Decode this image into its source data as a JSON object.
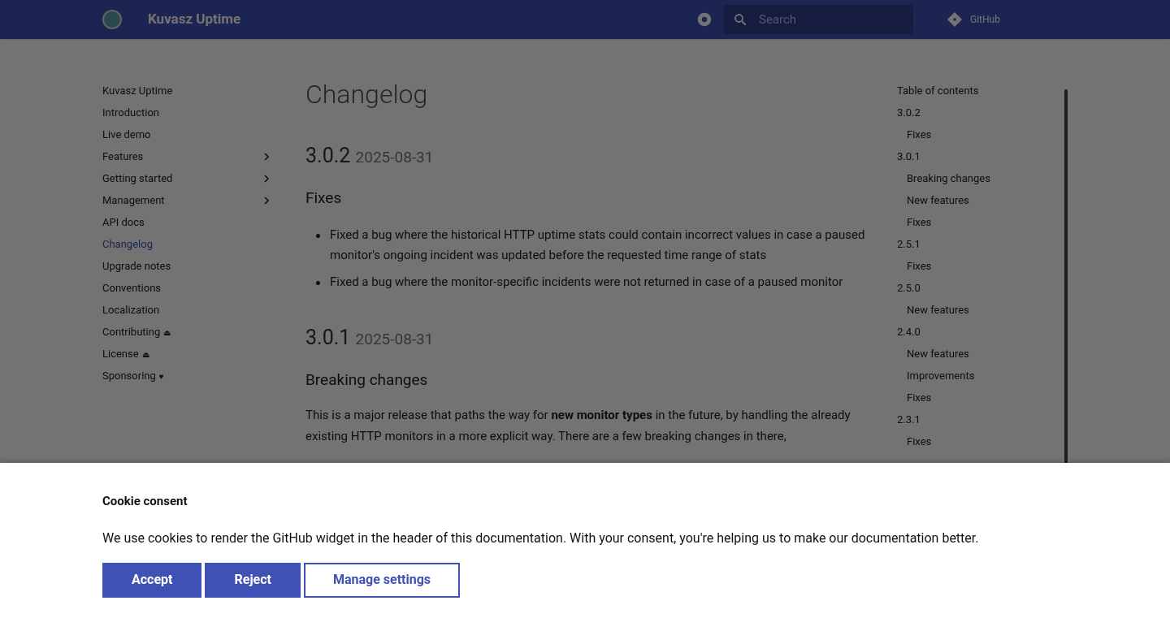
{
  "header": {
    "title": "Kuvasz Uptime",
    "search": {
      "placeholder": "Search"
    },
    "repo_link": "GitHub"
  },
  "sidebar": {
    "items": [
      {
        "label": "Kuvasz Uptime",
        "selected": false,
        "expandable": false
      },
      {
        "label": "Introduction",
        "selected": false,
        "expandable": false
      },
      {
        "label": "Live demo",
        "selected": false,
        "expandable": false
      },
      {
        "label": "Features",
        "selected": false,
        "expandable": true
      },
      {
        "label": "Getting started",
        "selected": false,
        "expandable": true
      },
      {
        "label": "Management",
        "selected": false,
        "expandable": true
      },
      {
        "label": "API docs",
        "selected": false,
        "expandable": false
      },
      {
        "label": "Changelog",
        "selected": true,
        "expandable": false
      },
      {
        "label": "Upgrade notes",
        "selected": false,
        "expandable": false
      },
      {
        "label": "Conventions",
        "selected": false,
        "expandable": false
      },
      {
        "label": "Localization",
        "selected": false,
        "expandable": false
      },
      {
        "label": "Contributing",
        "selected": false,
        "expandable": false,
        "suffix": "⏏"
      },
      {
        "label": "License",
        "selected": false,
        "expandable": false,
        "suffix": "⏏"
      },
      {
        "label": "Sponsoring",
        "selected": false,
        "expandable": false,
        "suffix": "♥"
      }
    ]
  },
  "content": {
    "title": "Changelog",
    "sections": [
      {
        "version": "3.0.2",
        "date": "2025-08-31",
        "subsections": [
          {
            "heading": "Fixes",
            "bullets": [
              "Fixed a bug where the historical HTTP uptime stats could contain incorrect values in case a paused monitor's ongoing incident was updated before the requested time range of stats",
              "Fixed a bug where the monitor-specific incidents were not returned in case of a paused monitor"
            ]
          }
        ]
      },
      {
        "version": "3.0.1",
        "date": "2025-08-31",
        "subsections": [
          {
            "heading": "Breaking changes",
            "paragraph": "This is a major release that paths the way for **new monitor types** in the future, by handling the already existing HTTP monitors in a more explicit way. There are a few breaking changes in there,"
          }
        ]
      }
    ]
  },
  "toc": {
    "title": "Table of contents",
    "items": [
      {
        "label": "3.0.2",
        "children": [
          {
            "label": "Fixes"
          }
        ]
      },
      {
        "label": "3.0.1",
        "children": [
          {
            "label": "Breaking changes"
          },
          {
            "label": "New features"
          },
          {
            "label": "Fixes"
          }
        ]
      },
      {
        "label": "2.5.1",
        "children": [
          {
            "label": "Fixes"
          }
        ]
      },
      {
        "label": "2.5.0",
        "children": [
          {
            "label": "New features"
          }
        ]
      },
      {
        "label": "2.4.0",
        "children": [
          {
            "label": "New features"
          },
          {
            "label": "Improvements"
          },
          {
            "label": "Fixes"
          }
        ]
      },
      {
        "label": "2.3.1",
        "children": [
          {
            "label": "Fixes"
          }
        ]
      }
    ]
  },
  "cookie_consent": {
    "title": "Cookie consent",
    "text": "We use cookies to render the GitHub widget in the header of this documentation. With your consent, you're helping us to make our documentation better.",
    "buttons": [
      {
        "label": "Accept",
        "kind": "primary"
      },
      {
        "label": "Reject",
        "kind": "primary"
      },
      {
        "label": "Manage settings",
        "kind": "outline"
      }
    ]
  }
}
